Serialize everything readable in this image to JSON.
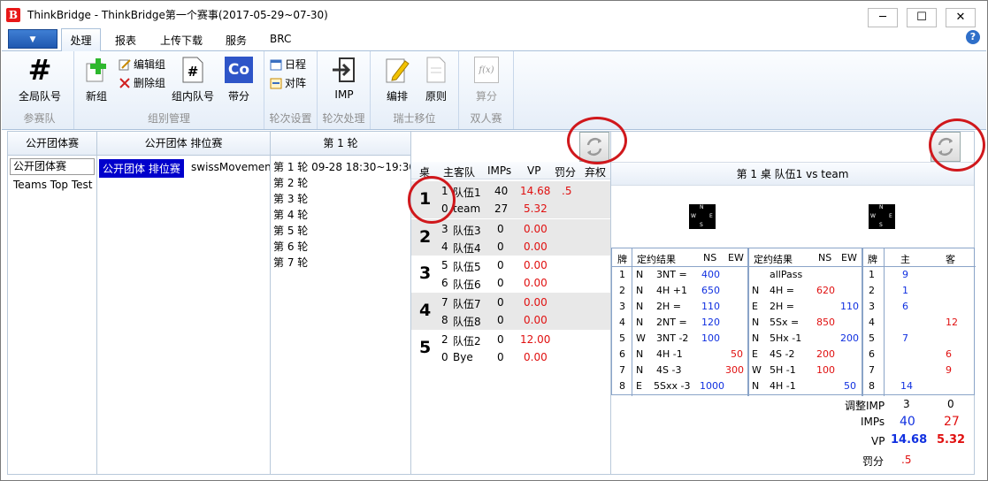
{
  "title": "ThinkBridge - ThinkBridge第一个赛事(2017-05-29~07-30)",
  "app_icon_letter": "B",
  "window_controls": {
    "minimize": "─",
    "maximize": "☐",
    "close": "✕"
  },
  "file_menu_arrow": "▼",
  "tabs": [
    "处理",
    "报表",
    "上传下载",
    "服务",
    "BRC"
  ],
  "help_glyph": "?",
  "ribbon": {
    "groups": [
      {
        "label": "参赛队",
        "buttons": [
          {
            "label": "全局队号",
            "icon": "hash-icon"
          }
        ]
      },
      {
        "label": "组别管理",
        "buttons": [
          {
            "label": "新组",
            "icon": "plus-icon"
          },
          {
            "label": "编辑组",
            "icon": "edit-icon"
          },
          {
            "label": "删除组",
            "icon": "x-icon"
          },
          {
            "label": "组内队号",
            "icon": "doc-hash-icon"
          },
          {
            "label": "带分",
            "icon": "co-icon"
          }
        ]
      },
      {
        "label": "轮次设置",
        "buttons": [
          {
            "label": "日程",
            "icon": "calendar-icon"
          },
          {
            "label": "对阵",
            "icon": "match-icon"
          }
        ]
      },
      {
        "label": "轮次处理",
        "buttons": [
          {
            "label": "IMP",
            "icon": "import-icon"
          }
        ]
      },
      {
        "label": "瑞士移位",
        "buttons": [
          {
            "label": "编排",
            "icon": "pencil-icon"
          },
          {
            "label": "原则",
            "icon": "page-icon"
          }
        ]
      },
      {
        "label": "双人赛",
        "buttons": [
          {
            "label": "算分",
            "icon": "fx-icon"
          }
        ]
      }
    ],
    "co_glyph": "Co",
    "fx_glyph": "f(x)",
    "hash_glyph": "#"
  },
  "pane1": {
    "header": "公开团体赛",
    "items": [
      "公开团体赛",
      "Teams Top Test"
    ]
  },
  "pane2": {
    "header": "公开团体 排位赛",
    "items": [
      "公开团体 排位赛",
      "swissMovement"
    ]
  },
  "pane3": {
    "header": "第 1 轮",
    "rounds": [
      "第 1 轮  09-28 18:30~19:30",
      "第 2 轮",
      "第 3 轮",
      "第 4 轮",
      "第 5 轮",
      "第 6 轮",
      "第 7 轮"
    ]
  },
  "pane4": {
    "headers": [
      "桌",
      "主客队",
      "IMPs",
      "VP",
      "罚分",
      "弃权"
    ],
    "rows": [
      {
        "table": "1",
        "a_no": "1",
        "a_name": "队伍1",
        "a_imps": "40",
        "a_vp": "14.68",
        "a_pen": ".5",
        "b_no": "0",
        "b_name": "team",
        "b_imps": "27",
        "b_vp": "5.32"
      },
      {
        "table": "2",
        "a_no": "3",
        "a_name": "队伍3",
        "a_imps": "0",
        "a_vp": "0.00",
        "a_pen": "",
        "b_no": "4",
        "b_name": "队伍4",
        "b_imps": "0",
        "b_vp": "0.00"
      },
      {
        "table": "3",
        "a_no": "5",
        "a_name": "队伍5",
        "a_imps": "0",
        "a_vp": "0.00",
        "a_pen": "",
        "b_no": "6",
        "b_name": "队伍6",
        "b_imps": "0",
        "b_vp": "0.00"
      },
      {
        "table": "4",
        "a_no": "7",
        "a_name": "队伍7",
        "a_imps": "0",
        "a_vp": "0.00",
        "a_pen": "",
        "b_no": "8",
        "b_name": "队伍8",
        "b_imps": "0",
        "b_vp": "0.00"
      },
      {
        "table": "5",
        "a_no": "2",
        "a_name": "队伍2",
        "a_imps": "0",
        "a_vp": "12.00",
        "a_pen": "",
        "b_no": "0",
        "b_name": "Bye",
        "b_imps": "0",
        "b_vp": "0.00"
      }
    ]
  },
  "pane5": {
    "title": "第 1 桌  队伍1 vs team",
    "compass": {
      "n": "N",
      "s": "S",
      "w": "W",
      "e": "E"
    },
    "headers": [
      "牌",
      "定约结果",
      "NS",
      "EW",
      "定约结果",
      "NS",
      "EW",
      "牌",
      "主",
      "客"
    ],
    "boards": [
      {
        "b1": "1",
        "d1": "N",
        "c1": "3NT =",
        "ns1": "400",
        "ew1": "",
        "d2": "",
        "c2": "allPass",
        "ns2": "",
        "ew2": "",
        "b2": "1",
        "h": "9",
        "a": ""
      },
      {
        "b1": "2",
        "d1": "N",
        "c1": "4H +1",
        "ns1": "650",
        "ew1": "",
        "d2": "N",
        "c2": "4H =",
        "ns2": "620",
        "ew2": "",
        "b2": "2",
        "h": "1",
        "a": ""
      },
      {
        "b1": "3",
        "d1": "N",
        "c1": "2H =",
        "ns1": "110",
        "ew1": "",
        "d2": "E",
        "c2": "2H =",
        "ns2": "",
        "ew2": "110",
        "b2": "3",
        "h": "6",
        "a": ""
      },
      {
        "b1": "4",
        "d1": "N",
        "c1": "2NT =",
        "ns1": "120",
        "ew1": "",
        "d2": "N",
        "c2": "5Sx =",
        "ns2": "850",
        "ew2": "",
        "b2": "4",
        "h": "",
        "a": "12"
      },
      {
        "b1": "5",
        "d1": "W",
        "c1": "3NT -2",
        "ns1": "100",
        "ew1": "",
        "d2": "N",
        "c2": "5Hx -1",
        "ns2": "",
        "ew2": "200",
        "b2": "5",
        "h": "7",
        "a": ""
      },
      {
        "b1": "6",
        "d1": "N",
        "c1": "4H -1",
        "ns1": "",
        "ew1": "50",
        "d2": "E",
        "c2": "4S -2",
        "ns2": "200",
        "ew2": "",
        "b2": "6",
        "h": "",
        "a": "6"
      },
      {
        "b1": "7",
        "d1": "N",
        "c1": "4S -3",
        "ns1": "",
        "ew1": "300",
        "d2": "W",
        "c2": "5H -1",
        "ns2": "100",
        "ew2": "",
        "b2": "7",
        "h": "",
        "a": "9"
      },
      {
        "b1": "8",
        "d1": "E",
        "c1": "5Sxx -3",
        "ns1": "1000",
        "ew1": "",
        "d2": "N",
        "c2": "4H -1",
        "ns2": "",
        "ew2": "50",
        "b2": "8",
        "h": "14",
        "a": ""
      }
    ],
    "summary": {
      "adj_label": "调整IMP",
      "adj_h": "3",
      "adj_a": "0",
      "imps_label": "IMPs",
      "imps_h": "40",
      "imps_a": "27",
      "vp_label": "VP",
      "vp_h": "14.68",
      "vp_a": "5.32",
      "pen_label": "罚分",
      "pen_h": ".5",
      "pen_a": ""
    }
  },
  "colors": {
    "accent_red": "#e01010",
    "accent_blue": "#1030e0",
    "highlight_circle": "#d0181c",
    "selection": "#0000cc"
  }
}
